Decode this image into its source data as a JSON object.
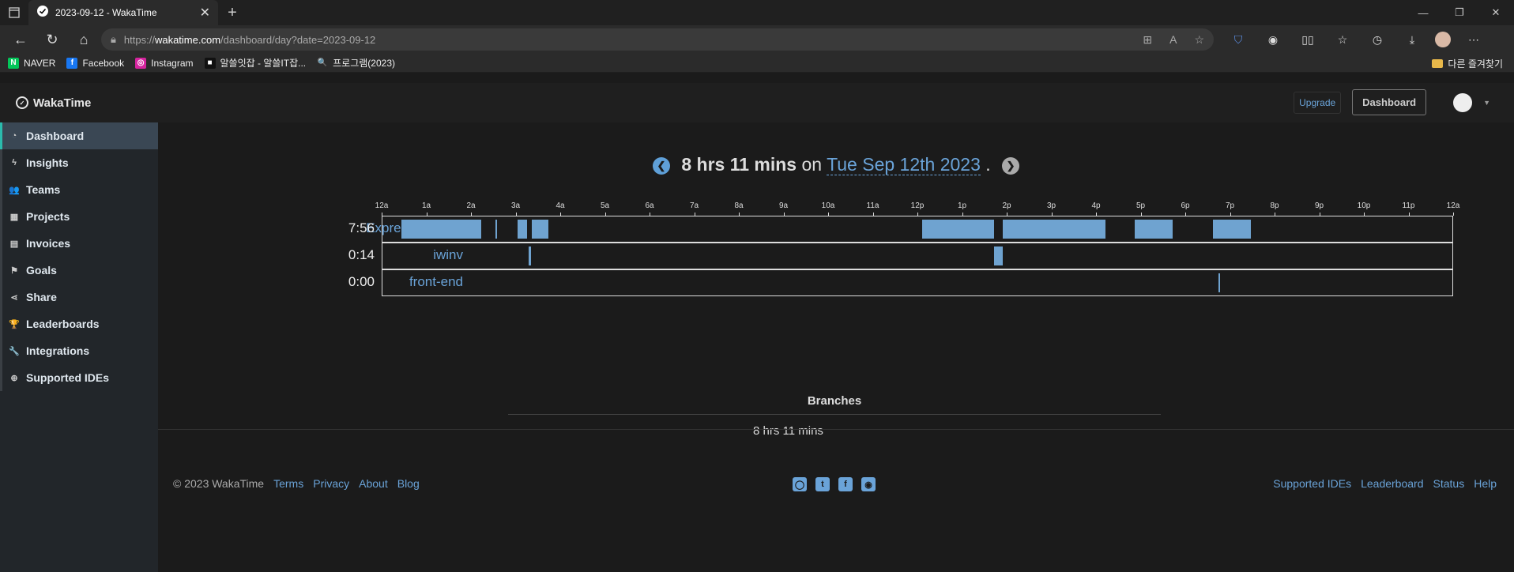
{
  "browser": {
    "tab_title": "2023-09-12 - WakaTime",
    "url_domain": "wakatime.com",
    "url_prefix": "https://",
    "url_path": "/dashboard/day?date=2023-09-12",
    "bookmarks": [
      {
        "label": "NAVER",
        "icon": "naver-icon",
        "color": "#03c75a",
        "glyph": "N"
      },
      {
        "label": "Facebook",
        "icon": "facebook-icon",
        "color": "#1877f2",
        "glyph": "f"
      },
      {
        "label": "Instagram",
        "icon": "instagram-icon",
        "color": "#d6249f",
        "glyph": "◎"
      },
      {
        "label": "알쓸잇잡 - 알쓸IT잡...",
        "icon": "alsseul-icon",
        "color": "#111111",
        "glyph": "■"
      },
      {
        "label": "프로그램(2023)",
        "icon": "search-icon",
        "color": "#2b2b2b",
        "glyph": "🔍"
      }
    ],
    "other_bookmarks": "다른 즐겨찾기"
  },
  "app": {
    "brand": "WakaTime",
    "upgrade_label": "Upgrade",
    "dashboard_label": "Dashboard"
  },
  "sidebar": {
    "items": [
      {
        "label": "Dashboard",
        "icon": "dashboard-icon",
        "glyph": "◔",
        "active": true
      },
      {
        "label": "Insights",
        "icon": "bolt-icon",
        "glyph": "ϟ"
      },
      {
        "label": "Teams",
        "icon": "users-icon",
        "glyph": "👥"
      },
      {
        "label": "Projects",
        "icon": "grid-icon",
        "glyph": "▦"
      },
      {
        "label": "Invoices",
        "icon": "invoice-icon",
        "glyph": "▤"
      },
      {
        "label": "Goals",
        "icon": "flag-icon",
        "glyph": "⚑"
      },
      {
        "label": "Share",
        "icon": "share-icon",
        "glyph": "⋖"
      },
      {
        "label": "Leaderboards",
        "icon": "trophy-icon",
        "glyph": "🏆"
      },
      {
        "label": "Integrations",
        "icon": "wrench-icon",
        "glyph": "🔧"
      },
      {
        "label": "Supported IDEs",
        "icon": "plus-circle-icon",
        "glyph": "⊕"
      }
    ]
  },
  "summary": {
    "duration": "8 hrs 11 mins",
    "on": "on",
    "date": "Tue Sep 12th 2023",
    "period": "."
  },
  "timeline": {
    "ticks": [
      "12a",
      "1a",
      "2a",
      "3a",
      "4a",
      "5a",
      "6a",
      "7a",
      "8a",
      "9a",
      "10a",
      "11a",
      "12p",
      "1p",
      "2p",
      "3p",
      "4p",
      "5p",
      "6p",
      "7p",
      "8p",
      "9p",
      "10p",
      "11p",
      "12a"
    ],
    "projects": [
      {
        "name": "ExpressjsCRUD",
        "time": "7:56",
        "segments": [
          [
            0.43,
            2.22
          ],
          [
            2.53,
            2.55
          ],
          [
            3.02,
            3.24
          ],
          [
            3.35,
            3.72
          ],
          [
            12.08,
            13.7
          ],
          [
            13.9,
            16.2
          ],
          [
            16.85,
            17.7
          ],
          [
            18.6,
            18.7
          ],
          [
            18.7,
            19.45
          ]
        ]
      },
      {
        "name": "iwinv",
        "time": "0:14",
        "segments": [
          [
            3.27,
            3.32
          ],
          [
            13.7,
            13.9
          ]
        ]
      },
      {
        "name": "front-end",
        "time": "0:00",
        "segments": [
          [
            18.73,
            18.75
          ]
        ]
      }
    ]
  },
  "branches": {
    "title": "Branches",
    "value": "8 hrs 11 mins"
  },
  "footer": {
    "copyright": "© 2023 WakaTime",
    "left_links": [
      "Terms",
      "Privacy",
      "About",
      "Blog"
    ],
    "social": [
      "github-icon",
      "twitter-icon",
      "facebook-icon",
      "reddit-icon"
    ],
    "right_links": [
      "Supported IDEs",
      "Leaderboard",
      "Status",
      "Help"
    ]
  }
}
